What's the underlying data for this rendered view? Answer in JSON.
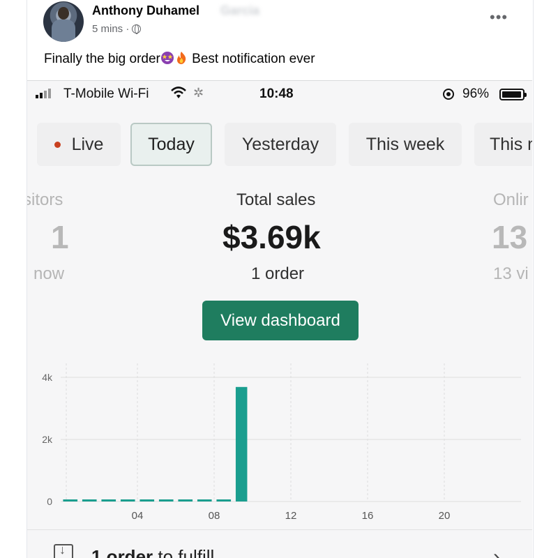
{
  "post": {
    "author_name": "Anthony Duhamel",
    "author_name_hidden": "Garcia",
    "time": "5 mins ·",
    "privacy_icon": "globe-icon",
    "more_icon": "more-icon",
    "text_before": "Finally the big order",
    "text_after": " Best notification ever",
    "emojis": [
      "star-struck-emoji",
      "fire-emoji"
    ]
  },
  "status_bar": {
    "carrier": "T-Mobile Wi-Fi",
    "time": "10:48",
    "battery_percent_label": "96%",
    "battery_level": 0.96
  },
  "tabs": [
    {
      "label": "Live",
      "active": false
    },
    {
      "label": "Today",
      "active": true
    },
    {
      "label": "Yesterday",
      "active": false
    },
    {
      "label": "This week",
      "active": false
    },
    {
      "label": "This m",
      "active": false
    }
  ],
  "metrics": {
    "left": {
      "label": "sitors",
      "value": "1",
      "sub": "now"
    },
    "center": {
      "label": "Total sales",
      "value": "$3.69k",
      "sub": "1 order"
    },
    "right": {
      "label": "Onlir",
      "value": "13",
      "sub": "13 vi"
    }
  },
  "dashboard_button": "View dashboard",
  "colors": {
    "accent": "#1f7d5f",
    "bar": "#1a9e8f",
    "live_dot": "#c8401f"
  },
  "chart_data": {
    "type": "bar",
    "x": [
      1,
      2,
      3,
      4,
      5,
      6,
      7,
      8,
      9,
      10
    ],
    "values": [
      0,
      0,
      0,
      0,
      0,
      0,
      0,
      0,
      0,
      3690
    ],
    "xticks": [
      "04",
      "08",
      "12",
      "16",
      "20"
    ],
    "xtick_positions": [
      4,
      8,
      12,
      16,
      20
    ],
    "yticks": [
      "0",
      "2k",
      "4k"
    ],
    "ytick_values": [
      0,
      2000,
      4000
    ],
    "ylim": [
      0,
      4000
    ],
    "xlim": [
      0,
      24
    ],
    "grid": true,
    "title": "",
    "xlabel": "",
    "ylabel": ""
  },
  "fulfill": {
    "count_text": "1 order",
    "rest_text": " to fulfill"
  }
}
